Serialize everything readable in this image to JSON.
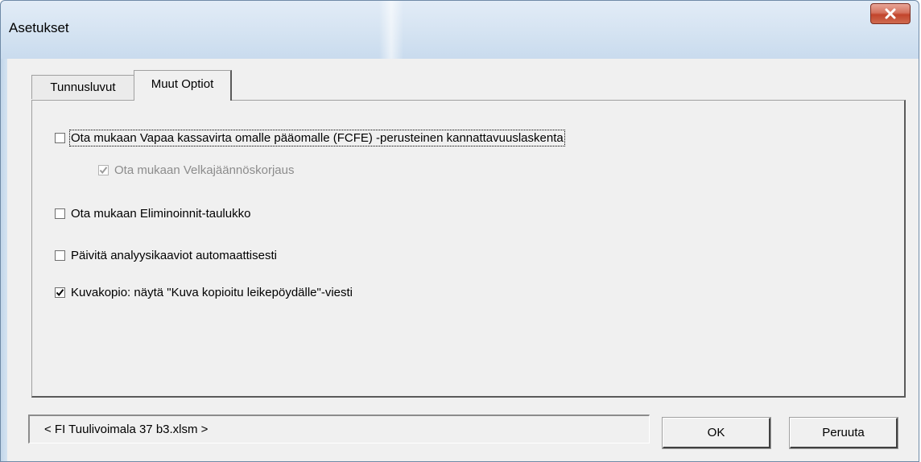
{
  "window": {
    "title": "Asetukset"
  },
  "tabs": [
    {
      "label": "Tunnusluvut",
      "active": false
    },
    {
      "label": "Muut Optiot",
      "active": true
    }
  ],
  "options": [
    {
      "label": "Ota mukaan Vapaa kassavirta omalle pääomalle (FCFE) -perusteinen kannattavuuslaskenta",
      "checked": false,
      "enabled": true
    },
    {
      "label": "Ota mukaan Velkajäännöskorjaus",
      "checked": true,
      "enabled": false
    },
    {
      "label": "Ota mukaan Eliminoinnit-taulukko",
      "checked": false,
      "enabled": true
    },
    {
      "label": "Päivitä analyysikaaviot automaattisesti",
      "checked": false,
      "enabled": true
    },
    {
      "label": "Kuvakopio: näytä \"Kuva kopioitu leikepöydälle\"-viesti",
      "checked": true,
      "enabled": true
    }
  ],
  "status": {
    "text": "< FI Tuulivoimala 37 b3.xlsm >"
  },
  "buttons": {
    "ok": "OK",
    "cancel": "Peruuta"
  },
  "colors": {
    "titlebar": "#d6e4f2",
    "close_button": "#c2452c",
    "dialog_face": "#f0f0f0"
  }
}
